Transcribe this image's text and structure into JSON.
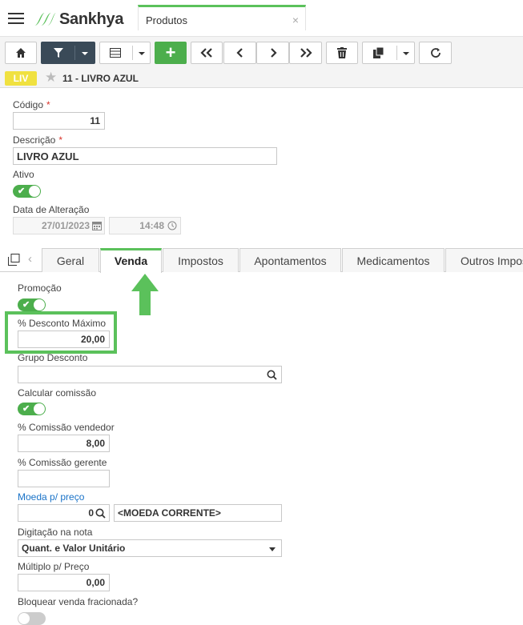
{
  "app": {
    "logo_text": "Sankhya",
    "tab_label": "Produtos",
    "tab_close": "×"
  },
  "breadcrumb": {
    "badge": "LIV",
    "title": "11 - LIVRO AZUL"
  },
  "form": {
    "codigo_label": "Código",
    "codigo_value": "11",
    "descricao_label": "Descrição",
    "descricao_value": "LIVRO AZUL",
    "ativo_label": "Ativo",
    "data_alteracao_label": "Data de Alteração",
    "data_value": "27/01/2023",
    "hora_value": "14:48",
    "required_mark": "*"
  },
  "tabs": [
    {
      "label": "Geral"
    },
    {
      "label": "Venda"
    },
    {
      "label": "Impostos"
    },
    {
      "label": "Apontamentos"
    },
    {
      "label": "Medicamentos"
    },
    {
      "label": "Outros Impos"
    }
  ],
  "venda": {
    "promocao_label": "Promoção",
    "desconto_label": "% Desconto Máximo",
    "desconto_value": "20,00",
    "grupo_desconto_label": "Grupo Desconto",
    "calcular_comissao_label": "Calcular comissão",
    "comissao_vendedor_label": "% Comissão vendedor",
    "comissao_vendedor_value": "8,00",
    "comissao_gerente_label": "% Comissão gerente",
    "moeda_label": "Moeda p/ preço",
    "moeda_code": "0",
    "moeda_name": "<MOEDA CORRENTE>",
    "digitacao_label": "Digitação na nota",
    "digitacao_value": "Quant. e Valor Unitário",
    "multiplo_label": "Múltiplo p/ Preço",
    "multiplo_value": "0,00",
    "bloquear_label": "Bloquear venda fracionada?"
  },
  "colors": {
    "accent_green": "#5bc15b",
    "toggle_green": "#4cae4c",
    "badge_yellow": "#f0e140",
    "link_blue": "#1a73c8",
    "toolbar_dark": "#3a4a58"
  }
}
